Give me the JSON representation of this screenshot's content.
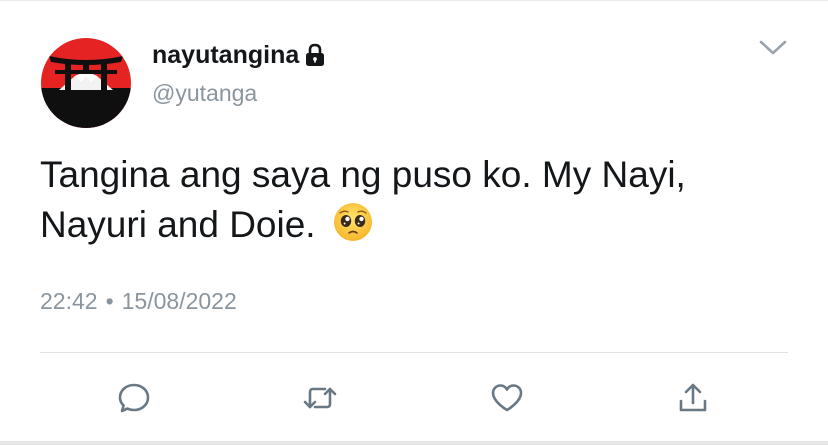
{
  "tweet": {
    "display_name": "nayutangina",
    "username": "@yutanga",
    "text": "Tangina ang saya ng puso ko. My Nayi, Nayuri and Doie.",
    "time": "22:42",
    "separator": "•",
    "date": "15/08/2022",
    "protected": true,
    "emoji": "pleading-face"
  },
  "actions": [
    {
      "name": "reply",
      "icon": "speech-bubble-icon"
    },
    {
      "name": "retweet",
      "icon": "retweet-arrows-icon"
    },
    {
      "name": "like",
      "icon": "heart-outline-icon"
    },
    {
      "name": "share",
      "icon": "share-upload-icon"
    }
  ],
  "colors": {
    "text": "#14171a",
    "secondary": "#8a959e",
    "icon": "#687885",
    "avatar_red": "#e52323",
    "divider": "#dfe3e6"
  }
}
